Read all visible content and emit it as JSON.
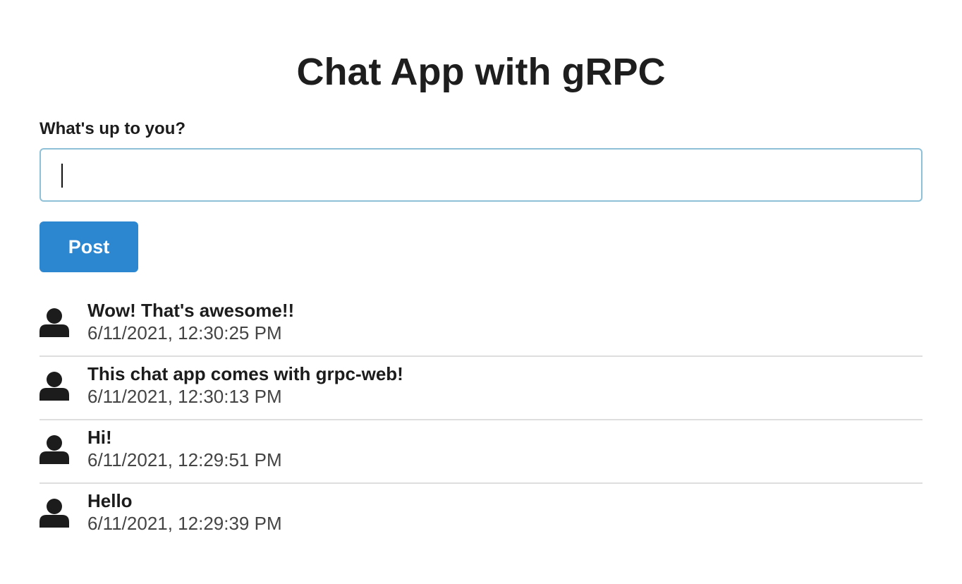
{
  "header": {
    "title": "Chat App with gRPC"
  },
  "form": {
    "label": "What's up to you?",
    "input_value": "",
    "input_placeholder": "",
    "post_label": "Post"
  },
  "colors": {
    "accent": "#2c86d0",
    "input_border": "#8ec1d8",
    "divider": "#dedede"
  },
  "messages": [
    {
      "text": "Wow! That's awesome!!",
      "time": "6/11/2021, 12:30:25 PM",
      "icon": "user-icon"
    },
    {
      "text": "This chat app comes with grpc-web!",
      "time": "6/11/2021, 12:30:13 PM",
      "icon": "user-icon"
    },
    {
      "text": "Hi!",
      "time": "6/11/2021, 12:29:51 PM",
      "icon": "user-icon"
    },
    {
      "text": "Hello",
      "time": "6/11/2021, 12:29:39 PM",
      "icon": "user-icon"
    }
  ]
}
